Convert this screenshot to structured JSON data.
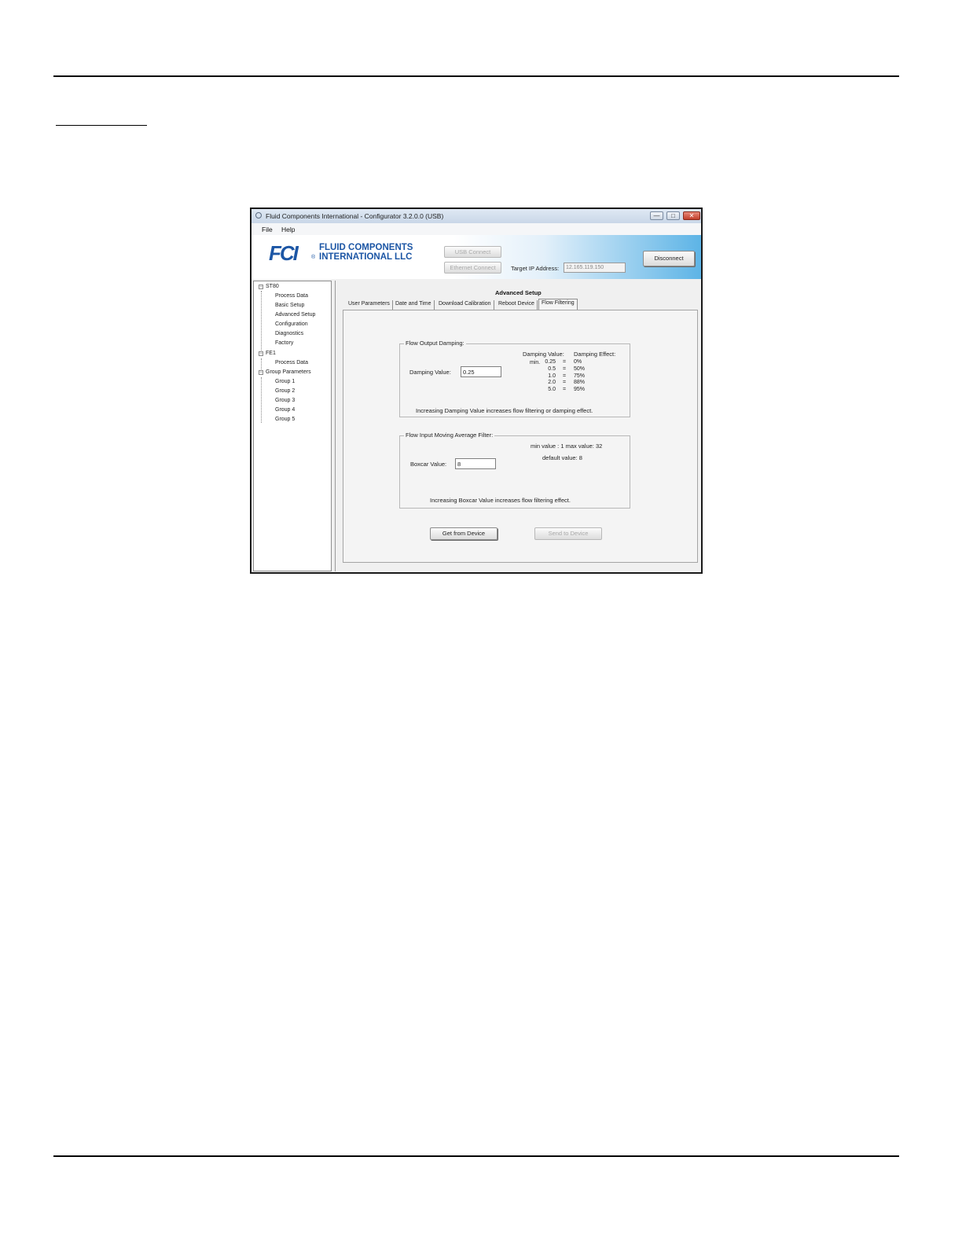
{
  "window": {
    "title": "Fluid Components International - Configurator 3.2.0.0 (USB)",
    "controls": {
      "minimize": "—",
      "maximize": "□",
      "close": "✕"
    }
  },
  "menu": [
    "File",
    "Help"
  ],
  "header": {
    "logo_mark": "FCI",
    "logo_line1": "FLUID COMPONENTS",
    "logo_line2": "INTERNATIONAL LLC",
    "logo_reg": "®",
    "usb_connect": "USB Connect",
    "ethernet_connect": "Ethernet Connect",
    "target_ip_label": "Target IP Address:",
    "target_ip_value": "12.165.119.150",
    "disconnect": "Disconnect"
  },
  "tree": {
    "st80": {
      "label": "ST80",
      "children": [
        "Process Data",
        "Basic Setup",
        "Advanced Setup",
        "Configuration",
        "Diagnostics",
        "Factory"
      ]
    },
    "fe1": {
      "label": "FE1",
      "children": [
        "Process Data"
      ]
    },
    "groups": {
      "label": "Group Parameters",
      "children": [
        "Group 1",
        "Group 2",
        "Group 3",
        "Group 4",
        "Group 5"
      ]
    }
  },
  "panel": {
    "title": "Advanced Setup",
    "tabs": [
      "User Parameters",
      "Date and Time",
      "Download Calibration",
      "Reboot Device",
      "Flow Filtering"
    ],
    "active_tab": "Flow Filtering"
  },
  "damping": {
    "legend": "Flow Output Damping:",
    "label": "Damping Value:",
    "value": "0.25",
    "col1_header": "Damping Value:",
    "col2_header": "Damping Effect:",
    "min_label": "min.",
    "rows": [
      {
        "value": "0.25",
        "sep": "=",
        "effect": "0%"
      },
      {
        "value": "0.5",
        "sep": "=",
        "effect": "50%"
      },
      {
        "value": "1.0",
        "sep": "=",
        "effect": "75%"
      },
      {
        "value": "2.0",
        "sep": "=",
        "effect": "88%"
      },
      {
        "value": "5.0",
        "sep": "=",
        "effect": "95%"
      }
    ],
    "note": "Increasing Damping Value increases flow filtering or damping effect."
  },
  "boxcar": {
    "legend": "Flow Input Moving Average Filter:",
    "label": "Boxcar Value:",
    "value": "8",
    "range": "min value : 1  max value: 32",
    "default": "default value: 8",
    "note": "Increasing Boxcar Value increases flow filtering effect."
  },
  "actions": {
    "get": "Get from Device",
    "send": "Send to Device"
  }
}
